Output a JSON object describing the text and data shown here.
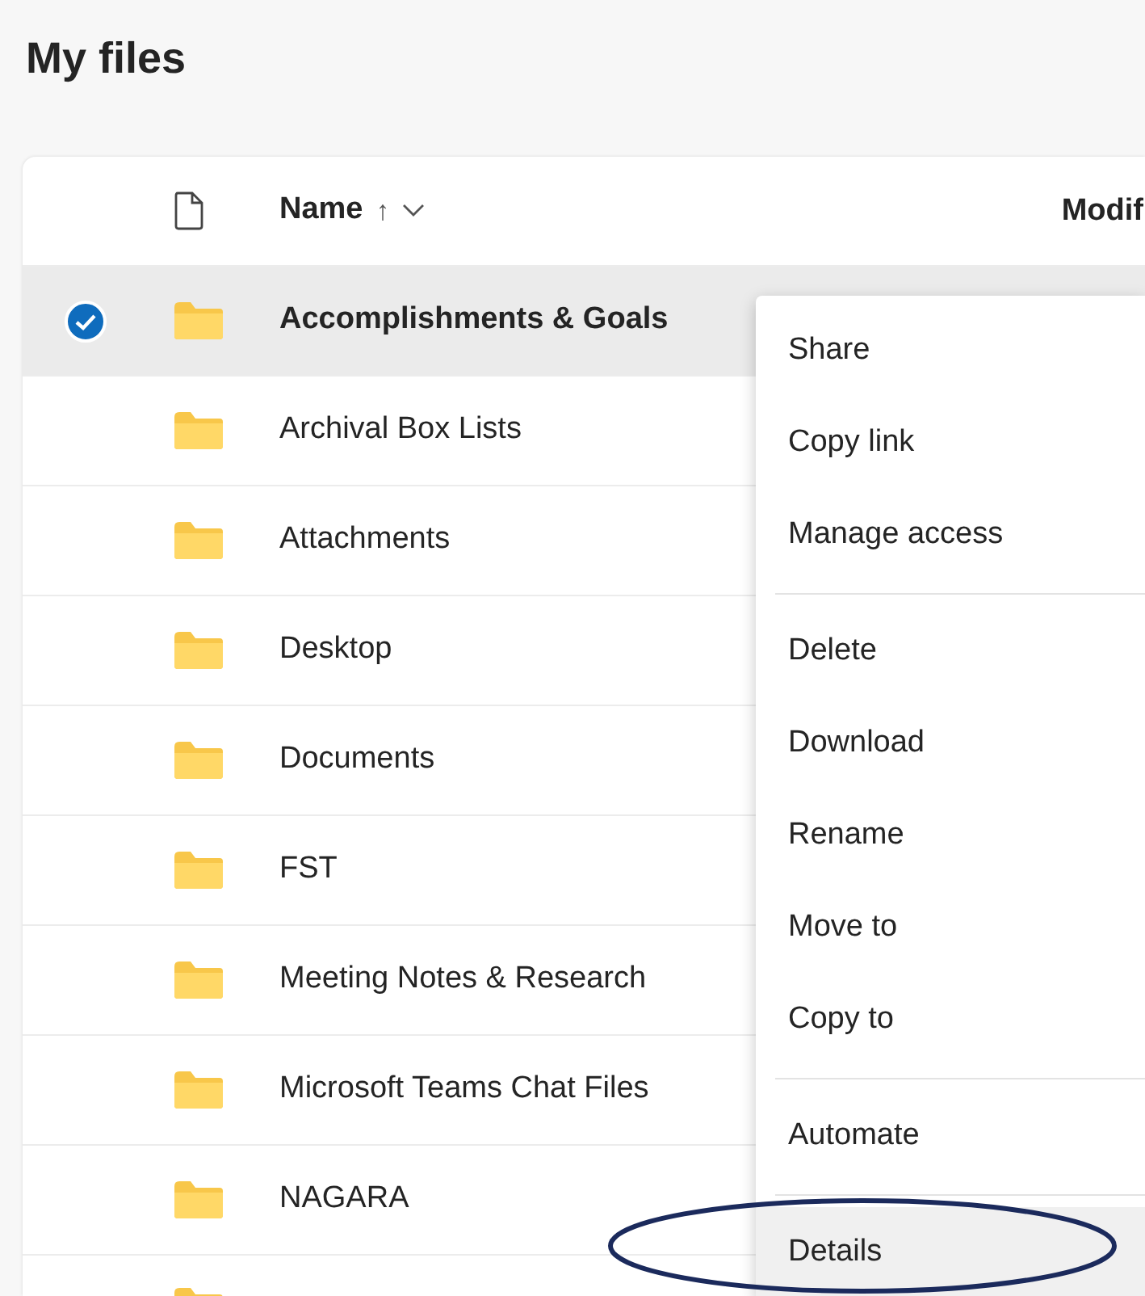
{
  "title": "My files",
  "table": {
    "columns": [
      {
        "kind": "file-icon"
      },
      {
        "kind": "name",
        "label": "Name",
        "sort_arrow": "↑"
      },
      {
        "kind": "text",
        "label": "Modif"
      }
    ],
    "rows": [
      {
        "name": "Accomplishments & Goals",
        "selected": true
      },
      {
        "name": "Archival Box Lists",
        "selected": false
      },
      {
        "name": "Attachments",
        "selected": false
      },
      {
        "name": "Desktop",
        "selected": false
      },
      {
        "name": "Documents",
        "selected": false
      },
      {
        "name": "FST",
        "selected": false
      },
      {
        "name": "Meeting Notes & Research",
        "selected": false
      },
      {
        "name": "Microsoft Teams Chat Files",
        "selected": false
      },
      {
        "name": "NAGARA",
        "selected": false
      },
      {
        "selected": false
      }
    ]
  },
  "context_menu": [
    {
      "kind": "item",
      "label": "Share",
      "selected": false
    },
    {
      "kind": "item",
      "label": "Copy link",
      "selected": false
    },
    {
      "kind": "item",
      "label": "Manage access",
      "selected": false
    },
    {
      "kind": "divider"
    },
    {
      "kind": "item",
      "label": "Delete",
      "selected": false
    },
    {
      "kind": "item",
      "label": "Download",
      "selected": false
    },
    {
      "kind": "item",
      "label": "Rename",
      "selected": false
    },
    {
      "kind": "item",
      "label": "Move to",
      "selected": false
    },
    {
      "kind": "item",
      "label": "Copy to",
      "selected": false
    },
    {
      "kind": "divider"
    },
    {
      "kind": "item",
      "label": "Automate",
      "selected": false
    },
    {
      "kind": "divider"
    },
    {
      "kind": "item",
      "label": "Details",
      "selected": true
    }
  ],
  "annotation": {
    "kind": "ellipse",
    "color": "#1b2a5c"
  }
}
